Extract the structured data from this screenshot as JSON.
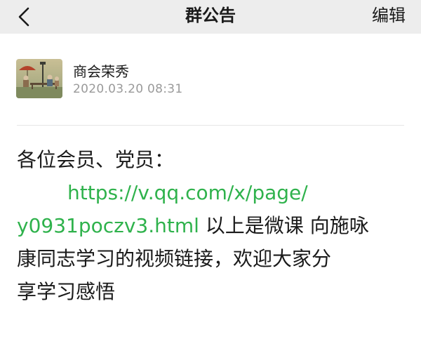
{
  "navbar": {
    "title": "群公告",
    "edit_label": "编辑",
    "back_icon": "chevron-left-icon"
  },
  "post": {
    "author": "商会荣秀",
    "time": "2020.03.20  08:31",
    "greeting": "各位会员、党员：",
    "link_part1": "https://v.qq.com/x/page/",
    "link_part2": "y0931poczv3.html",
    "text_after_link": " 以上是微课 向施咏",
    "line4": "康同志学习的视频链接，欢迎大家分",
    "line5": "享学习感悟"
  },
  "colors": {
    "navbar_bg": "#ededed",
    "link": "#2fb24c",
    "muted": "#9a9a9a"
  }
}
